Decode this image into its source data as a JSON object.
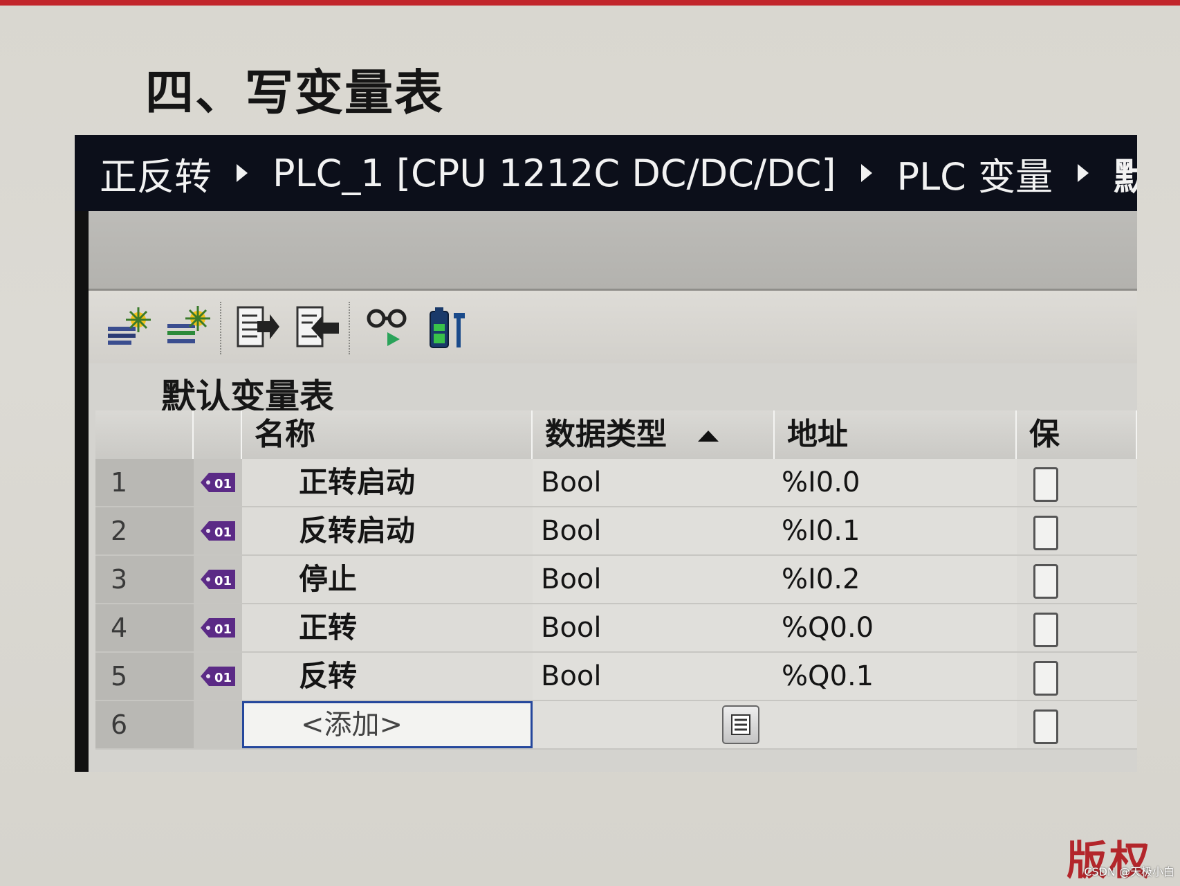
{
  "heading": "四、写变量表",
  "breadcrumb": {
    "items": [
      "正反转",
      "PLC_1 [CPU 1212C DC/DC/DC]",
      "PLC 变量",
      "默认"
    ]
  },
  "toolbar": {
    "buttons": [
      {
        "icon": "add-row-icon"
      },
      {
        "icon": "insert-row-icon"
      },
      {
        "icon": "export-icon"
      },
      {
        "icon": "import-icon"
      },
      {
        "icon": "monitor-glasses-icon"
      },
      {
        "icon": "battery-config-icon"
      }
    ]
  },
  "table": {
    "title": "默认变量表",
    "columns": {
      "name": "名称",
      "type": "数据类型",
      "address": "地址",
      "retain": "保"
    },
    "rows": [
      {
        "num": "1",
        "name": "正转启动",
        "type": "Bool",
        "address": "%I0.0"
      },
      {
        "num": "2",
        "name": "反转启动",
        "type": "Bool",
        "address": "%I0.1"
      },
      {
        "num": "3",
        "name": "停止",
        "type": "Bool",
        "address": "%I0.2"
      },
      {
        "num": "4",
        "name": "正转",
        "type": "Bool",
        "address": "%Q0.0"
      },
      {
        "num": "5",
        "name": "反转",
        "type": "Bool",
        "address": "%Q0.1"
      }
    ],
    "add_row": {
      "num": "6",
      "placeholder": "<添加>"
    }
  },
  "watermark": "CSDN @天极小白",
  "watermark_red": "版权",
  "colors": {
    "tag_icon": "#5b2a86",
    "selection_border": "#25479c",
    "top_strip": "#c2262b"
  }
}
